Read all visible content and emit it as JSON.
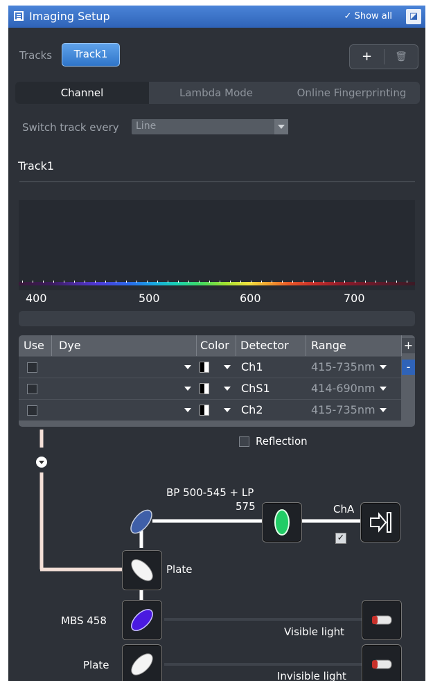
{
  "window": {
    "title": "Imaging Setup",
    "show_all": "Show all"
  },
  "tracks": {
    "label": "Tracks",
    "active": "Track1"
  },
  "tabs": [
    "Channel",
    "Lambda Mode",
    "Online Fingerprinting"
  ],
  "switch_track": {
    "label": "Switch track every",
    "value": "Line"
  },
  "section_title": "Track1",
  "spectrum_axis": [
    "400",
    "500",
    "600",
    "700"
  ],
  "table": {
    "headers": [
      "Use",
      "Dye",
      "Color",
      "Detector",
      "Range"
    ],
    "rows": [
      {
        "detector": "Ch1",
        "range": "415-735nm"
      },
      {
        "detector": "ChS1",
        "range": "414-690nm"
      },
      {
        "detector": "Ch2",
        "range": "415-735nm"
      }
    ],
    "add": "+",
    "remove": "-"
  },
  "reflection": "Reflection",
  "diagram": {
    "filter_label_1": "BP 500-545 + LP",
    "filter_label_2": "575",
    "channel": "ChA",
    "plate1": "Plate",
    "mbs": "MBS 458",
    "plate2": "Plate",
    "visible": "Visible light",
    "invisible": "Invisible light"
  }
}
